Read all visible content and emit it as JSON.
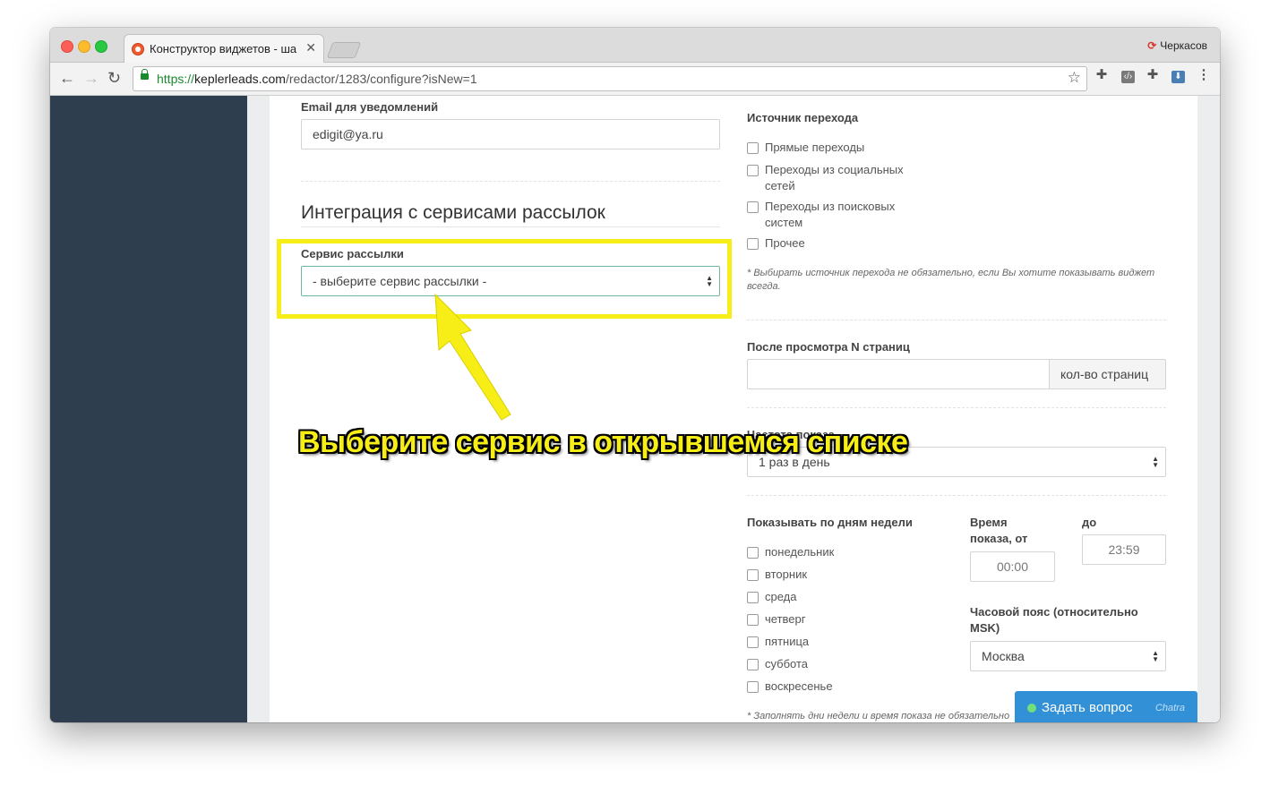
{
  "browser": {
    "tab_title": "Конструктор виджетов - шаг",
    "profile_name": "Черкасов",
    "url_scheme": "https://",
    "url_host": "keplerleads.com",
    "url_path": "/redactor/1283/configure?isNew=1"
  },
  "left": {
    "email_label": "Email для уведомлений",
    "email_value": "edigit@ya.ru",
    "integration_title": "Интеграция с сервисами рассылок",
    "service_label": "Сервис рассылки",
    "service_select": "- выберите сервис рассылки -"
  },
  "right": {
    "source_label": "Источник перехода",
    "sources": [
      {
        "line1": "Прямые переходы",
        "line2": ""
      },
      {
        "line1": "Переходы из социальных",
        "line2": "сетей"
      },
      {
        "line1": "Переходы из поисковых",
        "line2": "систем"
      },
      {
        "line1": "Прочее",
        "line2": ""
      }
    ],
    "source_hint": "* Выбирать источник перехода не обязательно, если Вы хотите показывать виджет всегда.",
    "pages_label": "После просмотра N страниц",
    "pages_addon": "кол-во страниц",
    "freq_label": "Частота показа",
    "freq_value": "1 раз в день",
    "days_label": "Показывать по дням недели",
    "days": [
      "понедельник",
      "вторник",
      "среда",
      "четверг",
      "пятница",
      "суббота",
      "воскресенье"
    ],
    "time_from_label_1": "Время",
    "time_from_label_2": "показа, от",
    "time_to_label": "до",
    "time_from": "00:00",
    "time_to": "23:59",
    "tz_label_1": "Часовой пояс (относительно",
    "tz_label_2": "MSK)",
    "tz_value": "Москва",
    "days_hint": "* Заполнять дни недели и время показа не обязательно"
  },
  "annotation": {
    "callout": "Выберите сервис в открывшемся списке",
    "color": "#f6ee16"
  },
  "chat": {
    "label": "Задать вопрос",
    "brand": "Chatra"
  }
}
